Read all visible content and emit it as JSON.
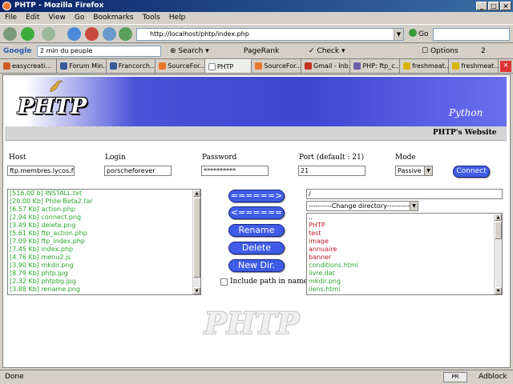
{
  "window": {
    "title": "PHTP - Mozilla Firefox"
  },
  "menu": [
    "File",
    "Edit",
    "View",
    "Go",
    "Bookmarks",
    "Tools",
    "Help"
  ],
  "nav": {
    "url": "http://localhost/phtp/index.php",
    "go_label": "Go"
  },
  "google_bar": {
    "logo": "Google",
    "query": "2 min du peuple",
    "search_label": "Search",
    "pagerank_label": "PageRank",
    "check_label": "Check",
    "options_label": "Options",
    "count": "2"
  },
  "tabs": [
    {
      "label": "easycreati...",
      "color": "#d05a20"
    },
    {
      "label": "Forum Min...",
      "color": "#3a5a9a"
    },
    {
      "label": "Francorch...",
      "color": "#3a5a9a"
    },
    {
      "label": "SourceFor...",
      "color": "#e8762b"
    },
    {
      "label": "PHTP",
      "color": "#ffffff",
      "active": true
    },
    {
      "label": "SourceFor...",
      "color": "#e8762b"
    },
    {
      "label": "Gmail - Inb...",
      "color": "#c23321"
    },
    {
      "label": "PHP: ftp_c...",
      "color": "#6a5fa8"
    },
    {
      "label": "freshmeat...",
      "color": "#d8b400"
    },
    {
      "label": "freshmeat...",
      "color": "#d8b400"
    }
  ],
  "banner": {
    "logo": "PHTP",
    "python": "Python",
    "website": "PHTP's Website"
  },
  "form": {
    "host_label": "Host",
    "host_value": "ftp.membres.lycos.fr",
    "login_label": "Login",
    "login_value": "porscheforever",
    "password_label": "Password",
    "password_value": "**********",
    "port_label": "Port (default : 21)",
    "port_value": "21",
    "mode_label": "Mode",
    "mode_value": "Passive",
    "connect_label": "Connect"
  },
  "local_files": [
    "[516.00 b] INSTALL.txt",
    "[20.00 Kb] Phile-Beta2.tar",
    "[6.57 Kb] action.php",
    "[2.94 Kb] connect.png",
    "[3.49 Kb] delete.png",
    "[5.61 Kb] ftp_action.php",
    "[7.09 Kb] ftp_index.php",
    "[7.45 Kb] index.php",
    "[4.76 Kb] menu2.js",
    "[3.90 Kb] mkdir.png",
    "[8.79 Kb] phtp.jpg",
    "[2.32 Kb] phtpbg.jpg",
    "[3.88 Kb] rename.png"
  ],
  "actions": {
    "upload": "======>",
    "download": "<======",
    "rename": "Rename",
    "delete": "Delete",
    "newdir": "New Dir.",
    "include_path": "Include path in name"
  },
  "remote": {
    "path": "/",
    "change_dir": "----------Change directory----------",
    "entries": [
      {
        "name": "..",
        "kind": "k"
      },
      {
        "name": "PHTP",
        "kind": "r"
      },
      {
        "name": "test",
        "kind": "r"
      },
      {
        "name": "image",
        "kind": "r"
      },
      {
        "name": "annuaire",
        "kind": "r"
      },
      {
        "name": "banner",
        "kind": "r"
      },
      {
        "name": "conditions.html",
        "kind": "g"
      },
      {
        "name": "livre.dat",
        "kind": "g"
      },
      {
        "name": "mkdir.png",
        "kind": "g"
      },
      {
        "name": "liens.html",
        "kind": "g"
      }
    ]
  },
  "watermark": "PHTP",
  "status": {
    "text": "Done",
    "badge": "PR",
    "adblock": "Adblock"
  }
}
